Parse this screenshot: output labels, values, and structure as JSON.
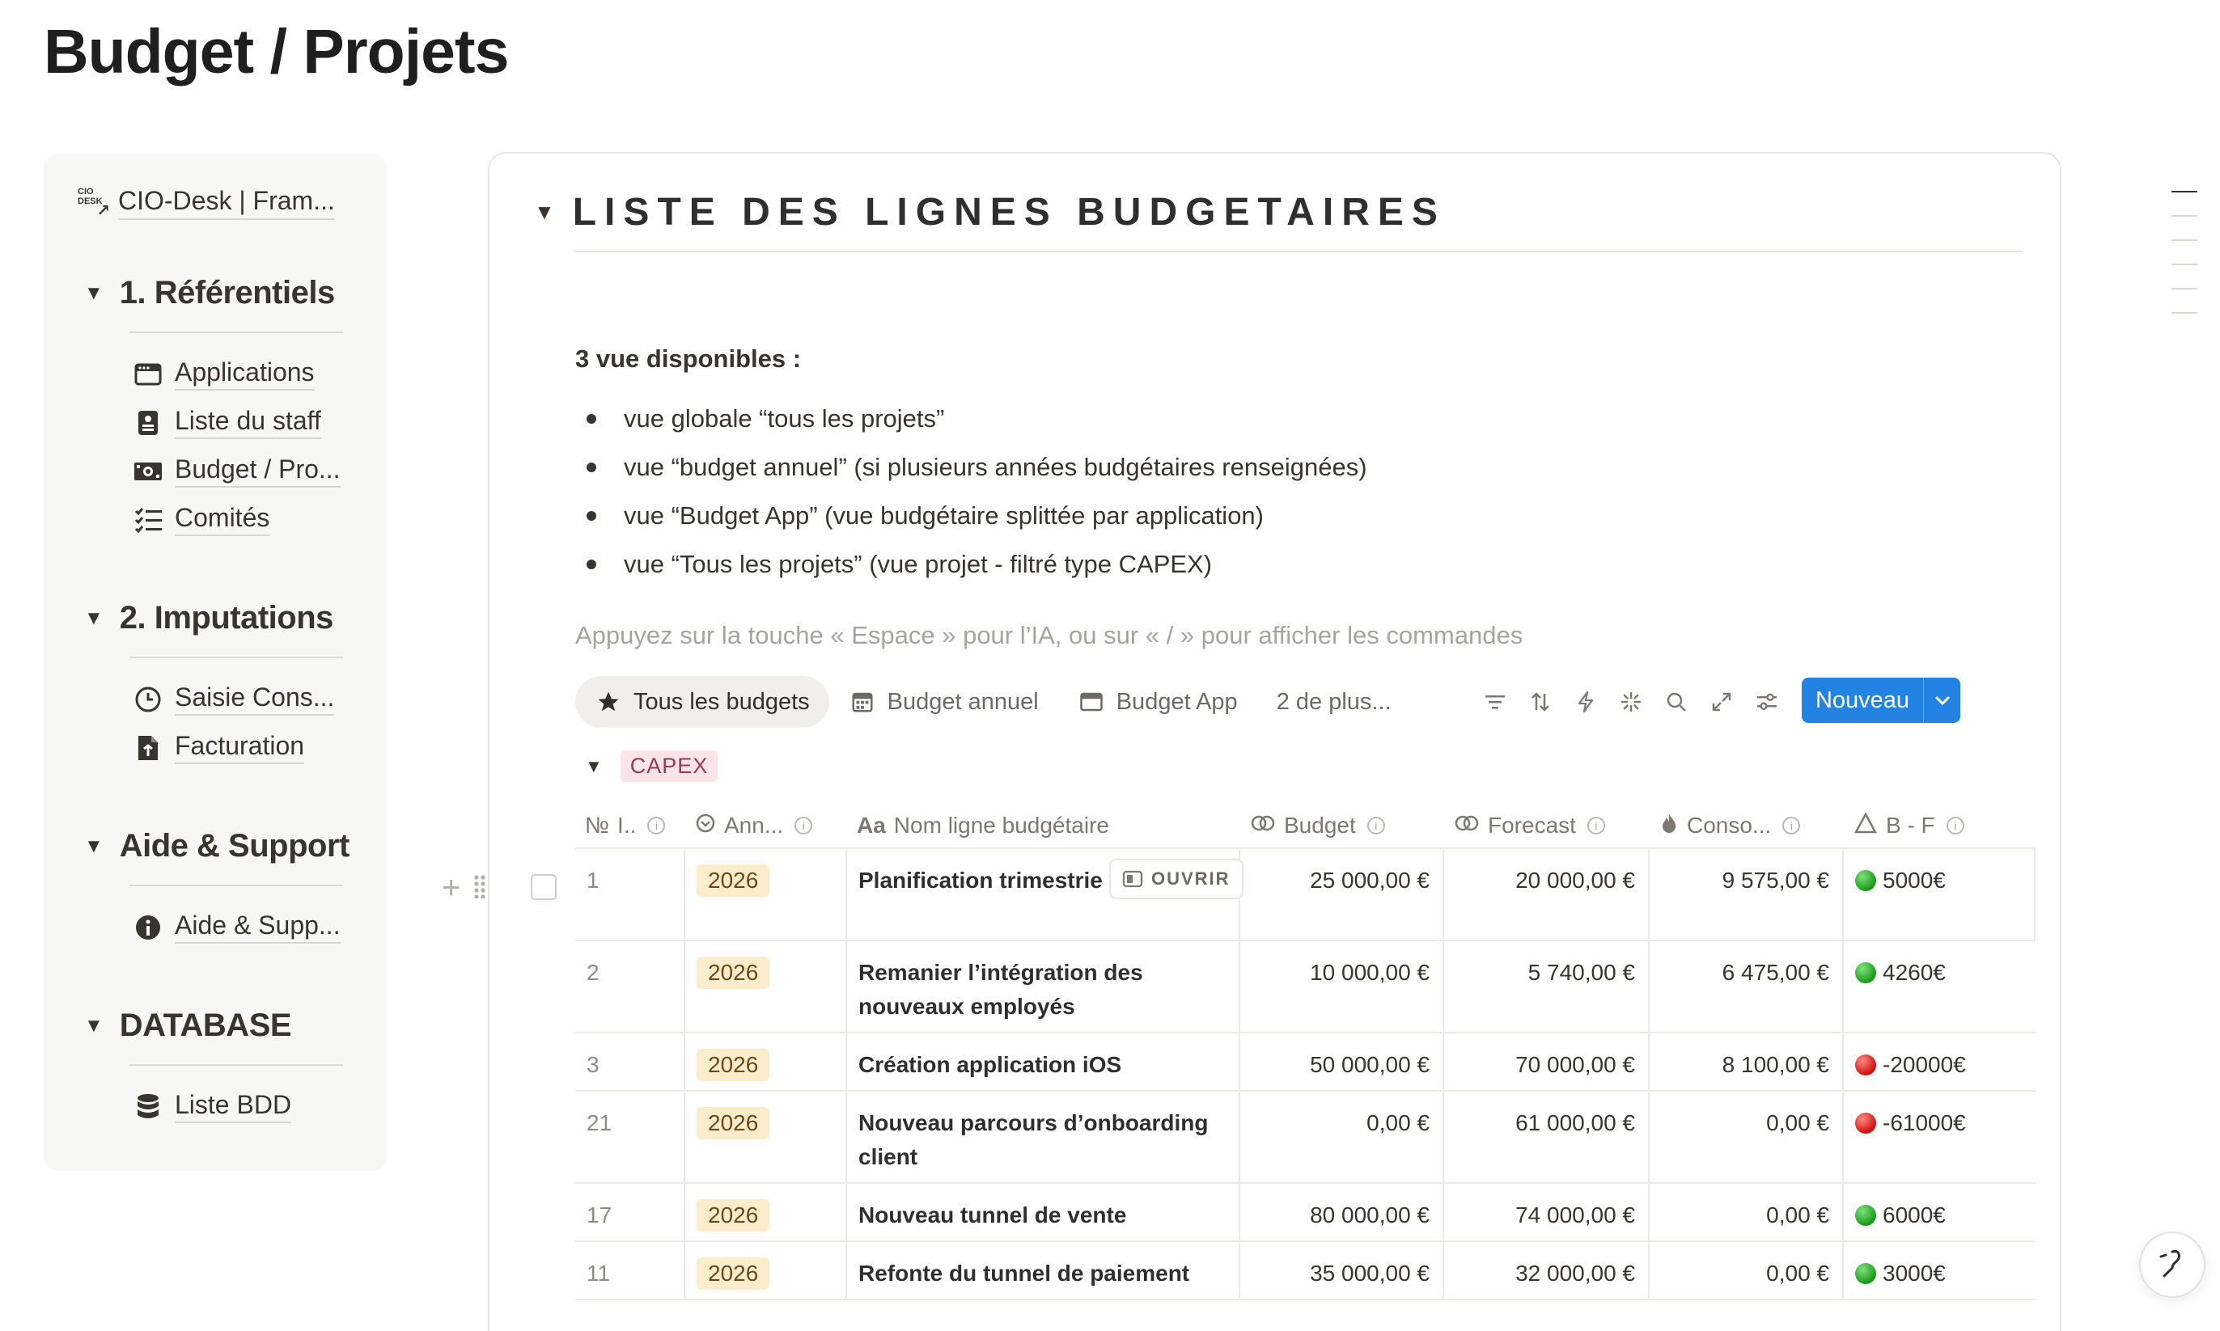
{
  "page": {
    "title": "Budget / Projets"
  },
  "sidebar": {
    "header": {
      "logo_text": "CIO DESK",
      "label": "CIO-Desk | Fram..."
    },
    "sections": [
      {
        "label": "1. Référentiels",
        "items": [
          {
            "label": "Applications",
            "icon": "window-icon"
          },
          {
            "label": "Liste du staff",
            "icon": "badge-icon"
          },
          {
            "label": "Budget / Pro...",
            "icon": "money-icon"
          },
          {
            "label": "Comités",
            "icon": "checklist-icon"
          }
        ]
      },
      {
        "label": "2. Imputations",
        "items": [
          {
            "label": "Saisie Cons...",
            "icon": "clock-icon"
          },
          {
            "label": "Facturation",
            "icon": "invoice-icon"
          }
        ]
      },
      {
        "label": "Aide & Support",
        "items": [
          {
            "label": "Aide & Supp...",
            "icon": "info-icon"
          }
        ]
      },
      {
        "label": "DATABASE",
        "items": [
          {
            "label": "Liste BDD",
            "icon": "database-icon"
          }
        ]
      }
    ]
  },
  "main": {
    "toggle_heading": "LISTE DES LIGNES BUDGETAIRES",
    "intro_bold": "3 vue disponibles :",
    "bullets": [
      "vue globale “tous les projets”",
      "vue “budget annuel” (si plusieurs années budgétaires renseignées)",
      "vue “Budget App” (vue budgétaire splittée par application)",
      "vue “Tous les projets” (vue projet - filtré type CAPEX)"
    ],
    "placeholder": "Appuyez sur la touche « Espace » pour l’IA, ou sur « / » pour afficher les commandes",
    "views": [
      {
        "label": "Tous les budgets",
        "icon": "star-icon",
        "active": true
      },
      {
        "label": "Budget annuel",
        "icon": "calendar-icon",
        "active": false
      },
      {
        "label": "Budget App",
        "icon": "board-icon",
        "active": false
      },
      {
        "label": "2 de plus...",
        "icon": "",
        "active": false
      }
    ],
    "toolbar_icons": [
      "filter-icon",
      "sort-icon",
      "automation-icon",
      "ai-sparkle-icon",
      "search-icon",
      "expand-icon",
      "settings-icon"
    ],
    "new_button": "Nouveau",
    "group_tag": "CAPEX",
    "table": {
      "columns": [
        {
          "label": "I..",
          "icon": "No"
        },
        {
          "label": "Ann...",
          "icon": "select-icon"
        },
        {
          "label": "Nom ligne budgétaire",
          "icon": "Aa"
        },
        {
          "label": "Budget",
          "icon": "rollup-icon"
        },
        {
          "label": "Forecast",
          "icon": "rollup-icon"
        },
        {
          "label": "Conso...",
          "icon": "flame-icon"
        },
        {
          "label": "B - F",
          "icon": "formula-icon"
        }
      ],
      "open_chip": "OUVRIR",
      "rows": [
        {
          "num": "1",
          "year": "2026",
          "name": "Planification trimestrie ventes",
          "budget": "25 000,00 €",
          "forecast": "20 000,00 €",
          "conso": "9 575,00 €",
          "bf": "5000€",
          "status": "green"
        },
        {
          "num": "2",
          "year": "2026",
          "name": "Remanier l’intégration des nouveaux employés",
          "budget": "10 000,00 €",
          "forecast": "5 740,00 €",
          "conso": "6 475,00 €",
          "bf": "4260€",
          "status": "green"
        },
        {
          "num": "3",
          "year": "2026",
          "name": "Création application iOS",
          "budget": "50 000,00 €",
          "forecast": "70 000,00 €",
          "conso": "8 100,00 €",
          "bf": "-20000€",
          "status": "red"
        },
        {
          "num": "21",
          "year": "2026",
          "name": "Nouveau parcours d’onboarding client",
          "budget": "0,00 €",
          "forecast": "61 000,00 €",
          "conso": "0,00 €",
          "bf": "-61000€",
          "status": "red"
        },
        {
          "num": "17",
          "year": "2026",
          "name": "Nouveau tunnel de vente",
          "budget": "80 000,00 €",
          "forecast": "74 000,00 €",
          "conso": "0,00 €",
          "bf": "6000€",
          "status": "green"
        },
        {
          "num": "11",
          "year": "2026",
          "name": "Refonte du tunnel de paiement",
          "budget": "35 000,00 €",
          "forecast": "32 000,00 €",
          "conso": "0,00 €",
          "bf": "3000€",
          "status": "green"
        }
      ]
    }
  }
}
